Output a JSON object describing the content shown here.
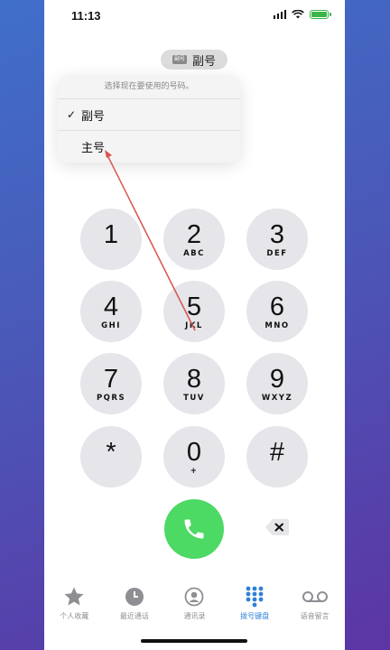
{
  "status": {
    "time": "11:13"
  },
  "sim": {
    "badge": "副号",
    "label": "副号"
  },
  "popup": {
    "title": "选择现在要使用的号码。",
    "items": [
      {
        "check": "✓",
        "label": "副号"
      },
      {
        "check": "",
        "label": "主号"
      }
    ]
  },
  "keypad": [
    {
      "digit": "1",
      "letters": ""
    },
    {
      "digit": "2",
      "letters": "ABC"
    },
    {
      "digit": "3",
      "letters": "DEF"
    },
    {
      "digit": "4",
      "letters": "GHI"
    },
    {
      "digit": "5",
      "letters": "JKL"
    },
    {
      "digit": "6",
      "letters": "MNO"
    },
    {
      "digit": "7",
      "letters": "PQRS"
    },
    {
      "digit": "8",
      "letters": "TUV"
    },
    {
      "digit": "9",
      "letters": "WXYZ"
    },
    {
      "digit": "*",
      "letters": ""
    },
    {
      "digit": "0",
      "letters": "+"
    },
    {
      "digit": "#",
      "letters": ""
    }
  ],
  "tabs": [
    {
      "icon": "star-icon",
      "label": "个人收藏"
    },
    {
      "icon": "clock-icon",
      "label": "最近通话"
    },
    {
      "icon": "contact-icon",
      "label": "通讯录"
    },
    {
      "icon": "keypad-icon",
      "label": "拨号键盘"
    },
    {
      "icon": "voicemail-icon",
      "label": "语音留言"
    }
  ],
  "colors": {
    "accent": "#2f80d7",
    "call": "#4cd964",
    "annotation": "#d9534f"
  }
}
